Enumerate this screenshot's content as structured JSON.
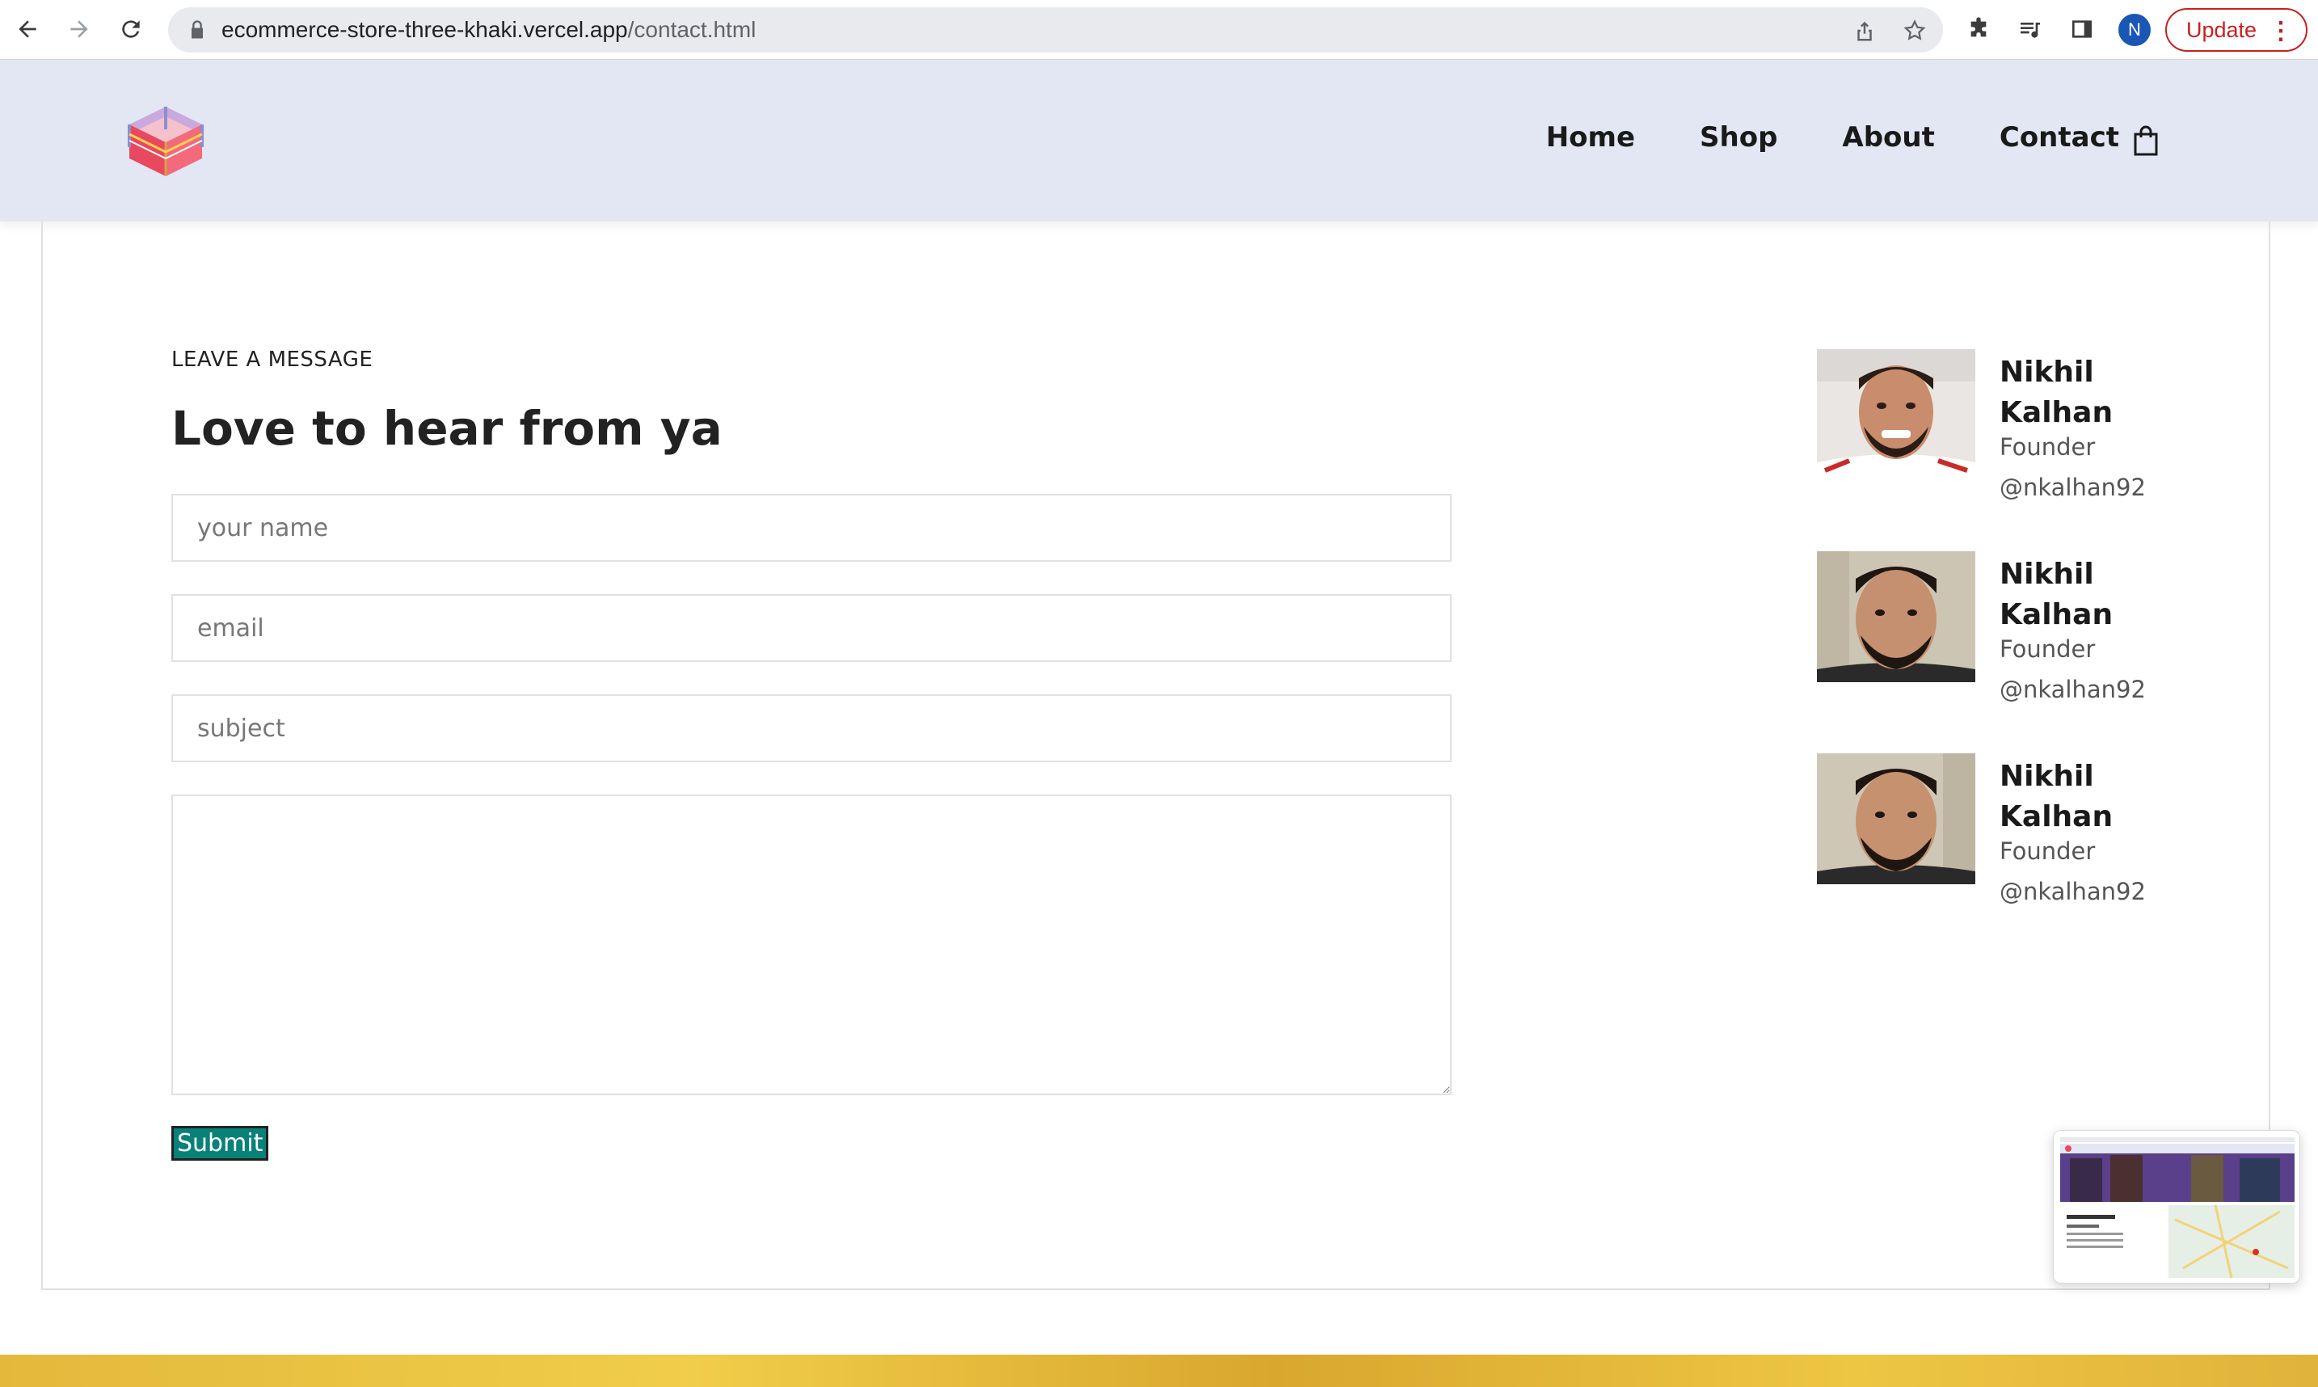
{
  "browser": {
    "url_host": "ecommerce-store-three-khaki.vercel.app",
    "url_path": "/contact.html",
    "profile_initial": "N",
    "update_label": "Update"
  },
  "header": {
    "nav": [
      {
        "label": "Home"
      },
      {
        "label": "Shop"
      },
      {
        "label": "About"
      },
      {
        "label": "Contact"
      }
    ]
  },
  "form": {
    "eyebrow": "LEAVE A MESSAGE",
    "heading": "Love to hear from ya",
    "name_placeholder": "your name",
    "email_placeholder": "email",
    "subject_placeholder": "subject",
    "message_value": "",
    "submit_label": "Submit"
  },
  "people": [
    {
      "name": "Nikhil Kalhan",
      "role": "Founder",
      "handle": "@nkalhan92"
    },
    {
      "name": "Nikhil Kalhan",
      "role": "Founder",
      "handle": "@nkalhan92"
    },
    {
      "name": "Nikhil Kalhan",
      "role": "Founder",
      "handle": "@nkalhan92"
    }
  ],
  "colors": {
    "header_bg": "#e3e6f3",
    "accent": "#088178",
    "update_red": "#c5221f",
    "footer_gold": "#e3b93c"
  }
}
